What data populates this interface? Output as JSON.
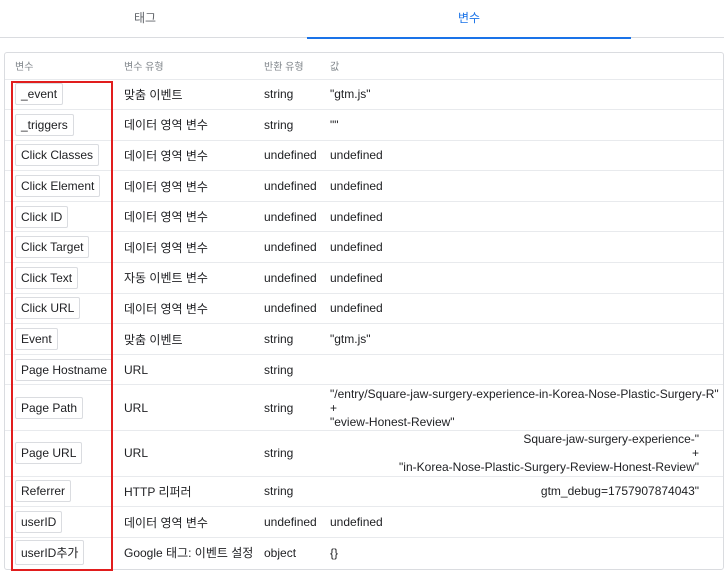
{
  "tabs": [
    {
      "label": "태그",
      "active": false
    },
    {
      "label": "변수",
      "active": true
    }
  ],
  "table": {
    "headers": [
      "변수",
      "변수 유형",
      "반환 유형",
      "값"
    ],
    "rows": [
      {
        "name": "_event",
        "type": "맞춤 이벤트",
        "return": "string",
        "value": "\"gtm.js\""
      },
      {
        "name": "_triggers",
        "type": "데이터 영역 변수",
        "return": "string",
        "value": "\"\""
      },
      {
        "name": "Click Classes",
        "type": "데이터 영역 변수",
        "return": "undefined",
        "value": "undefined"
      },
      {
        "name": "Click Element",
        "type": "데이터 영역 변수",
        "return": "undefined",
        "value": "undefined"
      },
      {
        "name": "Click ID",
        "type": "데이터 영역 변수",
        "return": "undefined",
        "value": "undefined"
      },
      {
        "name": "Click Target",
        "type": "데이터 영역 변수",
        "return": "undefined",
        "value": "undefined"
      },
      {
        "name": "Click Text",
        "type": "자동 이벤트 변수",
        "return": "undefined",
        "value": "undefined"
      },
      {
        "name": "Click URL",
        "type": "데이터 영역 변수",
        "return": "undefined",
        "value": "undefined"
      },
      {
        "name": "Event",
        "type": "맞춤 이벤트",
        "return": "string",
        "value": "\"gtm.js\""
      },
      {
        "name": "Page Hostname",
        "type": "URL",
        "return": "string",
        "value": ""
      },
      {
        "name": "Page Path",
        "type": "URL",
        "return": "string",
        "value": "\"/entry/Square-jaw-surgery-experience-in-Korea-Nose-Plastic-Surgery-R\"\n+\n\"eview-Honest-Review\""
      },
      {
        "name": "Page URL",
        "type": "URL",
        "return": "string",
        "value": "Square-jaw-surgery-experience-\"\n+\n\"in-Korea-Nose-Plastic-Surgery-Review-Honest-Review\""
      },
      {
        "name": "Referrer",
        "type": "HTTP 리퍼러",
        "return": "string",
        "value": "gtm_debug=1757907874043\""
      },
      {
        "name": "userID",
        "type": "데이터 영역 변수",
        "return": "undefined",
        "value": "undefined"
      },
      {
        "name": "userID추가",
        "type": "Google 태그: 이벤트 설정",
        "return": "object",
        "value": "{}"
      }
    ]
  },
  "colors": {
    "accent": "#1a73e8",
    "highlight": "#e11d1d",
    "border": "#dadce0"
  }
}
